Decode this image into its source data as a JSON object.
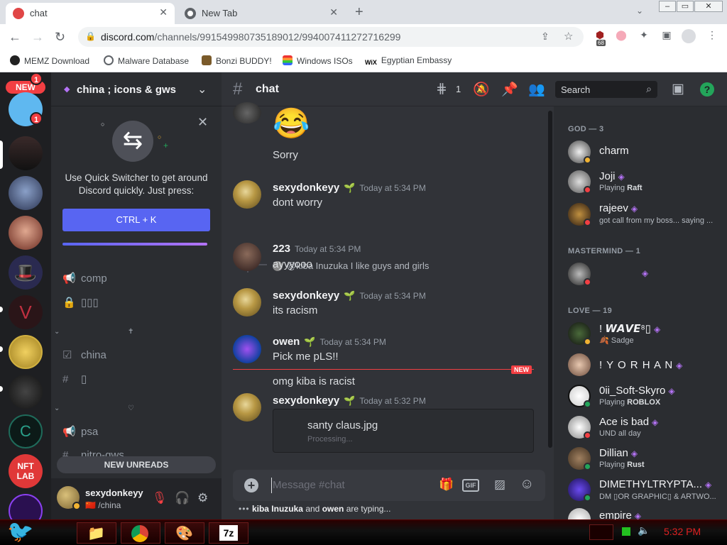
{
  "browser": {
    "tabs": [
      {
        "title": "chat",
        "active": true,
        "icon": "discord-notification-icon"
      },
      {
        "title": "New Tab",
        "active": false,
        "icon": "chrome-icon"
      }
    ],
    "url_domain": "discord.com",
    "url_path": "/channels/991549980735189012/994007411272716299",
    "extension_badge": "68",
    "bookmarks": [
      "MEMZ Download",
      "Malware Database",
      "Bonzi BUDDY!",
      "Windows ISOs",
      "Egyptian Embassy"
    ],
    "wix_label": "WiX"
  },
  "servers": {
    "new_badge": "NEW",
    "top_mention": "1",
    "mention": "1",
    "nft_label": "NFT\nLAB"
  },
  "guild": {
    "name": "china ; icons & gws",
    "quick_switcher_text": "Use Quick Switcher to get around Discord quickly. Just press:",
    "quick_switcher_button": "CTRL + K",
    "channels": [
      {
        "name": "comp",
        "icon": "megaphone-icon"
      },
      {
        "name": "▯▯▯",
        "icon": "lock-icon"
      },
      {
        "name": "china",
        "icon": "rules-icon"
      },
      {
        "name": "▯",
        "icon": "hash-icon"
      },
      {
        "name": "psa",
        "icon": "megaphone-icon"
      },
      {
        "name": "nitro-gws",
        "icon": "hash-icon"
      }
    ],
    "category_marks": [
      "✝",
      "♡"
    ],
    "new_unreads": "NEW UNREADS"
  },
  "user": {
    "name": "sexydonkeyy",
    "status": "🇨🇳 /china"
  },
  "chat": {
    "channel": "chat",
    "thread_count": "1",
    "search_placeholder": "Search",
    "messages": [
      {
        "emoji": "😂",
        "text": "Sorry"
      },
      {
        "author": "sexydonkeyy",
        "time": "Today at 5:34 PM",
        "text": "dont worry"
      },
      {
        "reply": "@kiba Inuzuka I like guys and girls",
        "author": "223",
        "time": "Today at 5:34 PM",
        "text": "ayyyooo"
      },
      {
        "author": "sexydonkeyy",
        "time": "Today at 5:34 PM",
        "text": "its racism"
      },
      {
        "author": "owen",
        "time": "Today at 5:34 PM",
        "text": "Pick me pLS!!"
      },
      {
        "text": "omg kiba is racist"
      },
      {
        "author": "sexydonkeyy",
        "time": "Today at 5:32 PM",
        "attachment": "santy claus.jpg",
        "attachment_status": "Processing..."
      }
    ],
    "new_label": "NEW",
    "composer_placeholder": "Message #chat",
    "gif_label": "GIF",
    "typing_names": [
      "kiba Inuzuka",
      "owen"
    ],
    "typing_joiner": "and",
    "typing_suffix": "are typing..."
  },
  "members": {
    "categories": [
      {
        "label": "GOD — 3",
        "members": [
          {
            "name": "charm",
            "activity": ""
          },
          {
            "name": "Joji",
            "activity_prefix": "Playing",
            "activity": "Raft"
          },
          {
            "name": "rajeev",
            "activity": "got call from my boss... saying ..."
          }
        ]
      },
      {
        "label": "MASTERMIND — 1",
        "members": [
          {
            "name": "",
            "activity": ""
          }
        ]
      },
      {
        "label": "LOVE — 19",
        "members": [
          {
            "name": "! 𝙒𝘼𝙑𝙀⁸▯",
            "activity": "🍂 Sadge"
          },
          {
            "name": "! Y O R H A N",
            "activity": ""
          },
          {
            "name": "0ii_Soft-Skyro",
            "activity_prefix": "Playing",
            "activity": "ROBLOX"
          },
          {
            "name": "Ace is bad",
            "activity": "UND all day"
          },
          {
            "name": "Dillian",
            "activity_prefix": "Playing",
            "activity": "Rust"
          },
          {
            "name": "DIMETHYLTRYPTA...",
            "activity": "DM ▯OR GRAPHIC▯ & ARTWO..."
          },
          {
            "name": "empire",
            "activity": ""
          }
        ]
      }
    ]
  },
  "taskbar": {
    "clock": "5:32 PM",
    "apps": [
      "file-explorer-icon",
      "chrome-icon",
      "paint-icon",
      "7zip-icon"
    ],
    "sevenzip_label": "7z"
  },
  "colors": {
    "blurple": "#5865f2",
    "online": "#23a55a",
    "dnd": "#f23f43",
    "idle": "#f0b232",
    "nitro": "#b473f5"
  }
}
